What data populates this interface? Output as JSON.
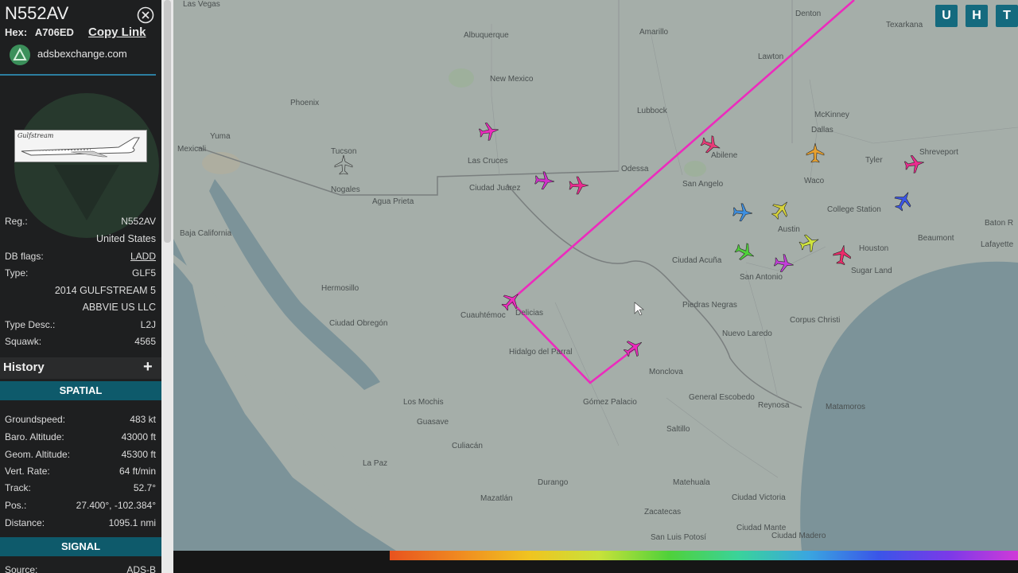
{
  "header": {
    "callsign": "N552AV",
    "hex_label": "Hex:",
    "hex": "A706ED",
    "copy_link": "Copy Link",
    "site": "adsbexchange.com"
  },
  "thumbnail": {
    "brand": "Gulfstream"
  },
  "details": {
    "reg_label": "Reg.:",
    "reg": "N552AV",
    "country": "United States",
    "db_flags_label": "DB flags:",
    "db_flags": "LADD",
    "type_label": "Type:",
    "type": "GLF5",
    "year_model": "2014 GULFSTREAM 5",
    "operator": "ABBVIE US LLC",
    "type_desc_label": "Type Desc.:",
    "type_desc": "L2J",
    "squawk_label": "Squawk:",
    "squawk": "4565"
  },
  "history": {
    "label": "History",
    "plus": "+"
  },
  "spatial": {
    "header": "SPATIAL",
    "groundspeed_label": "Groundspeed:",
    "groundspeed": "483 kt",
    "baro_label": "Baro. Altitude:",
    "baro": "43000 ft",
    "geom_label": "Geom. Altitude:",
    "geom": "45300 ft",
    "vrate_label": "Vert. Rate:",
    "vrate": "64 ft/min",
    "track_label": "Track:",
    "track": "52.7°",
    "pos_label": "Pos.:",
    "pos": "27.400°, -102.384°",
    "distance_label": "Distance:",
    "distance": "1095.1 nmi"
  },
  "signal": {
    "header": "SIGNAL",
    "source_label": "Source:",
    "source": "ADS-B"
  },
  "map_buttons": [
    "U",
    "H",
    "T"
  ],
  "map_labels": [
    {
      "text": "Las Vegas"
    },
    {
      "text": "Albuquerque"
    },
    {
      "text": "Amarillo"
    },
    {
      "text": "Lawton"
    },
    {
      "text": "Denton"
    },
    {
      "text": "Texarkana"
    },
    {
      "text": "Phoenix"
    },
    {
      "text": "New Mexico"
    },
    {
      "text": "Lubbock"
    },
    {
      "text": "McKinney"
    },
    {
      "text": "Dallas"
    },
    {
      "text": "Shreveport"
    },
    {
      "text": "Mexicali"
    },
    {
      "text": "Yuma"
    },
    {
      "text": "Tucson"
    },
    {
      "text": "Las Cruces"
    },
    {
      "text": "Odessa"
    },
    {
      "text": "Abilene"
    },
    {
      "text": "Tyler"
    },
    {
      "text": "Ciudad Juárez"
    },
    {
      "text": "San Angelo"
    },
    {
      "text": "Waco"
    },
    {
      "text": "Nogales"
    },
    {
      "text": "Agua Prieta"
    },
    {
      "text": "College Station"
    },
    {
      "text": "Austin"
    },
    {
      "text": "Baton R"
    },
    {
      "text": "Hermosillo"
    },
    {
      "text": "San Antonio"
    },
    {
      "text": "Houston"
    },
    {
      "text": "Beaumont"
    },
    {
      "text": "Lafayette"
    },
    {
      "text": "Baja California"
    },
    {
      "text": "Ciudad Acuña"
    },
    {
      "text": "Piedras Negras"
    },
    {
      "text": "Sugar Land"
    },
    {
      "text": "Cuauhtémoc"
    },
    {
      "text": "Delicias"
    },
    {
      "text": "Corpus Christi"
    },
    {
      "text": "Hidalgo del Parral"
    },
    {
      "text": "Monclova"
    },
    {
      "text": "Nuevo Laredo"
    },
    {
      "text": "Ciudad Obregón"
    },
    {
      "text": "Los Mochis"
    },
    {
      "text": "Guasave"
    },
    {
      "text": "Gómez Palacio"
    },
    {
      "text": "General Escobedo"
    },
    {
      "text": "Reynosa"
    },
    {
      "text": "Matamoros"
    },
    {
      "text": "Culiacán"
    },
    {
      "text": "Saltillo"
    },
    {
      "text": "La Paz"
    },
    {
      "text": "Durango"
    },
    {
      "text": "Mazatlán"
    },
    {
      "text": "Zacatecas"
    },
    {
      "text": "Matehuala"
    },
    {
      "text": "Ciudad Victoria"
    },
    {
      "text": "San Luis Potosí"
    },
    {
      "text": "Ciudad Mante"
    },
    {
      "text": "Ciudad Madero"
    }
  ],
  "colors": {
    "sidebar_bg": "#1e1f20",
    "section_header": "#0e5a6b",
    "track_line": "#ec2bbd",
    "map_land": "#a5aea9",
    "map_water": "#7c9399"
  }
}
